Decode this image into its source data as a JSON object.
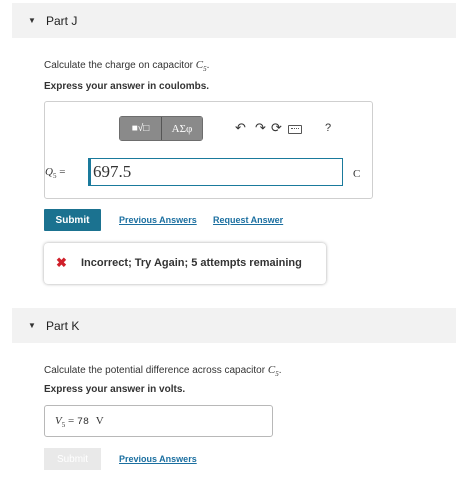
{
  "part_j": {
    "caret": "▼",
    "title": "Part J",
    "question_prefix": "Calculate the charge on capacitor ",
    "question_var": "C",
    "question_sub": "5",
    "question_suffix": ".",
    "instruction": "Express your answer in coulombs.",
    "toolbar": {
      "templates_label": "■√□",
      "symbols_label": "ΑΣφ",
      "undo_icon": "↶",
      "redo_icon": "↷",
      "reset_icon": "⟳",
      "keyboard_icon": "keyboard-icon",
      "help_label": "?"
    },
    "answer_var": "Q",
    "answer_sub": "5",
    "equals": "=",
    "answer_value": "697.5",
    "unit": "C",
    "submit_label": "Submit",
    "previous_answers_link": "Previous Answers",
    "request_answer_link": "Request Answer",
    "feedback": {
      "icon": "✖",
      "message": "Incorrect; Try Again; 5 attempts remaining"
    }
  },
  "part_k": {
    "caret": "▼",
    "title": "Part K",
    "question_prefix": "Calculate the potential difference across capacitor ",
    "question_var": "C",
    "question_sub": "5",
    "question_suffix": ".",
    "instruction": "Express your answer in volts.",
    "answer_var": "V",
    "answer_sub": "5",
    "equals": "=",
    "answer_value": "78",
    "unit": "V",
    "submit_label": "Submit",
    "previous_answers_link": "Previous Answers"
  },
  "colors": {
    "header_bg": "#f2f2f2",
    "primary": "#1b7290",
    "link": "#1b6fa0",
    "error": "#d0202a",
    "input_focus": "#1a7a9c"
  }
}
